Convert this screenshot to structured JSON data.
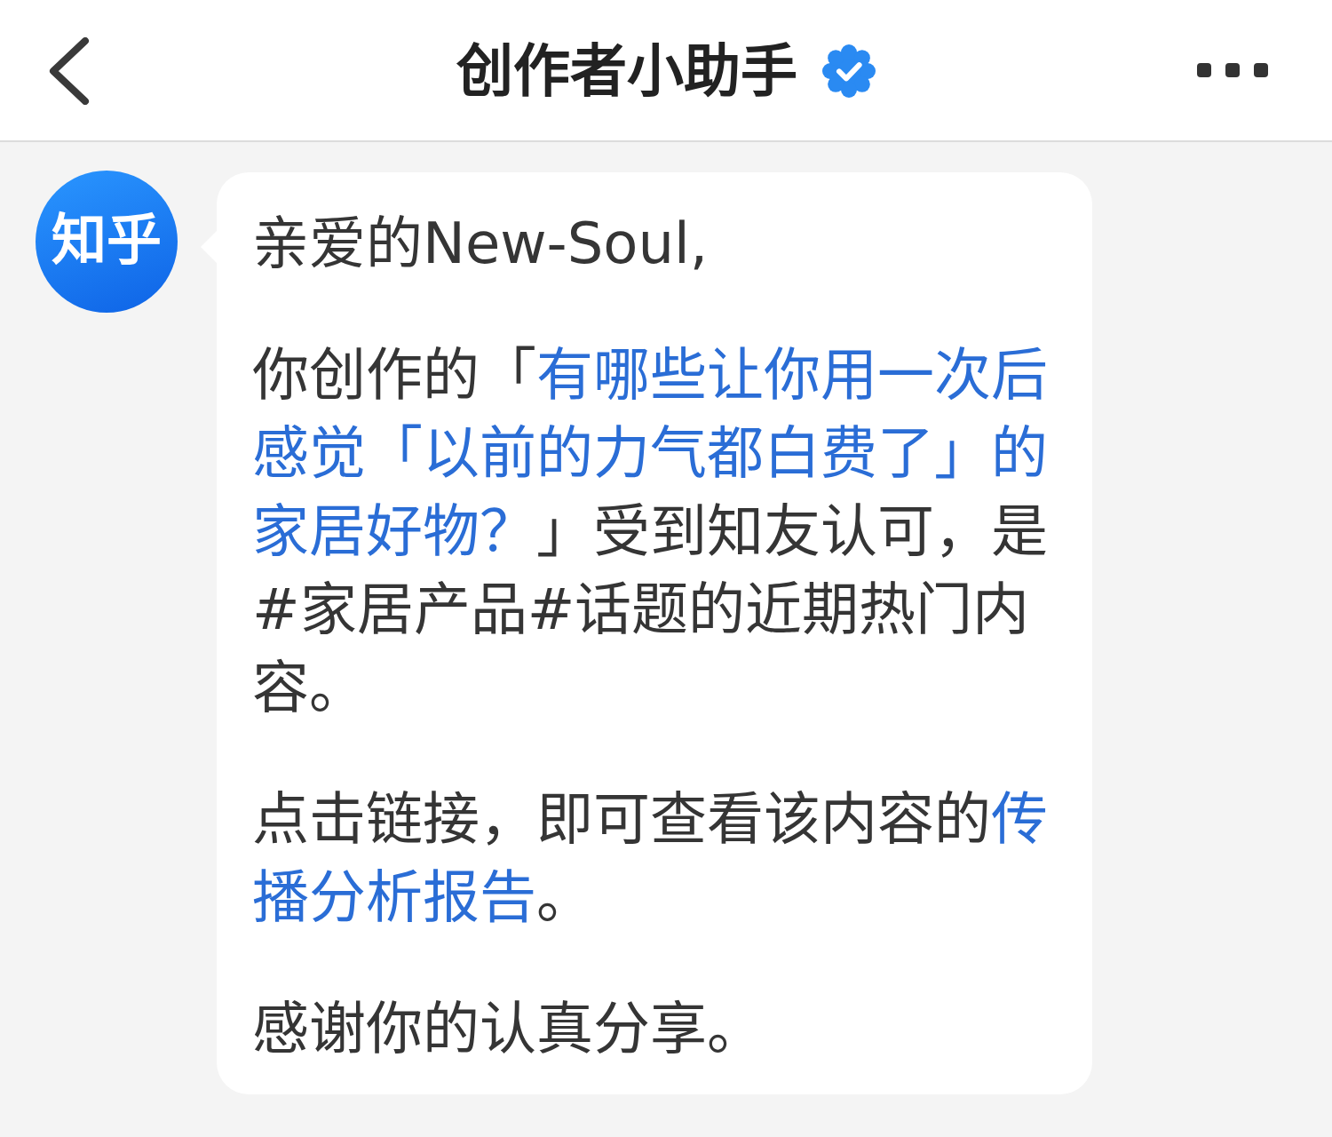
{
  "header": {
    "title": "创作者小助手",
    "verified": true
  },
  "message": {
    "avatar": "知乎",
    "paragraphs": [
      {
        "segments": [
          {
            "kind": "text",
            "text": "亲爱的New-Soul,"
          }
        ]
      },
      {
        "segments": [
          {
            "kind": "text",
            "text": "你创作的「"
          },
          {
            "kind": "link",
            "text": "有哪些让你用一次后感觉「以前的力气都白费了」的家居好物？"
          },
          {
            "kind": "text",
            "text": "」受到知友认可，是#家居产品#话题的近期热门内容。"
          }
        ]
      },
      {
        "segments": [
          {
            "kind": "text",
            "text": "点击链接，即可查看该内容的"
          },
          {
            "kind": "link",
            "text": "传播分析报告"
          },
          {
            "kind": "text",
            "text": "。"
          }
        ]
      },
      {
        "segments": [
          {
            "kind": "text",
            "text": "感谢你的认真分享。"
          }
        ]
      }
    ]
  }
}
